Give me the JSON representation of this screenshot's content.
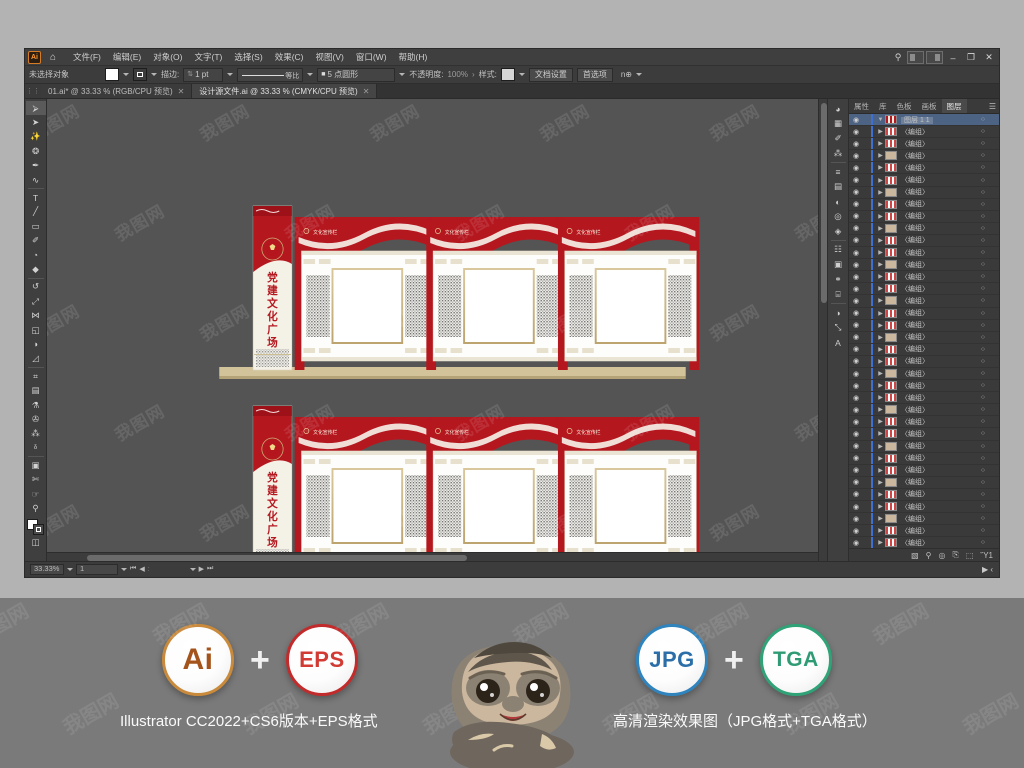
{
  "app": {
    "name": "Adobe Illustrator",
    "logo_text": "Ai",
    "home_icon": "home-icon",
    "search_icon": "search-icon",
    "minimize": "–",
    "restore": "❐",
    "close": "✕"
  },
  "menu": {
    "items": [
      {
        "label": "文件(F)"
      },
      {
        "label": "编辑(E)"
      },
      {
        "label": "对象(O)"
      },
      {
        "label": "文字(T)"
      },
      {
        "label": "选择(S)"
      },
      {
        "label": "效果(C)"
      },
      {
        "label": "视图(V)"
      },
      {
        "label": "窗口(W)"
      },
      {
        "label": "帮助(H)"
      }
    ]
  },
  "control_bar": {
    "selection_status": "未选择对象",
    "stroke_label": "描边:",
    "stroke_weight": "1 pt",
    "stroke_profile": "等比",
    "brush_definition": "5 点圆形",
    "opacity_label": "不透明度:",
    "opacity_value": "100%",
    "style_label": "样式:",
    "document_setup": "文档设置",
    "preferences": "首选项",
    "align_label": "n⊕"
  },
  "tabs": [
    {
      "label": "01.ai* @ 33.33 % (RGB/CPU 预览)",
      "active": false,
      "close": "✕"
    },
    {
      "label": "设计源文件.ai @ 33.33 % (CMYK/CPU 预览)",
      "active": true,
      "close": "✕"
    }
  ],
  "toolbar": {
    "tools": [
      {
        "name": "selection-tool",
        "glyph": "⮚",
        "selected": true
      },
      {
        "name": "direct-selection-tool",
        "glyph": "➤"
      },
      {
        "name": "magic-wand-tool",
        "glyph": "✨"
      },
      {
        "name": "lasso-tool",
        "glyph": "❂"
      },
      {
        "name": "pen-tool",
        "glyph": "✒"
      },
      {
        "name": "curvature-tool",
        "glyph": "∿"
      },
      {
        "name": "type-tool",
        "glyph": "T"
      },
      {
        "name": "line-segment-tool",
        "glyph": "╱"
      },
      {
        "name": "rectangle-tool",
        "glyph": "▭"
      },
      {
        "name": "paintbrush-tool",
        "glyph": "✐"
      },
      {
        "name": "shaper-tool",
        "glyph": "◔"
      },
      {
        "name": "eraser-tool",
        "glyph": "◆"
      },
      {
        "name": "rotate-tool",
        "glyph": "↺"
      },
      {
        "name": "scale-tool",
        "glyph": "⤢"
      },
      {
        "name": "width-tool",
        "glyph": "⋈"
      },
      {
        "name": "free-transform-tool",
        "glyph": "◱"
      },
      {
        "name": "shape-builder-tool",
        "glyph": "◑"
      },
      {
        "name": "perspective-grid-tool",
        "glyph": "◿"
      },
      {
        "name": "mesh-tool",
        "glyph": "⌗"
      },
      {
        "name": "gradient-tool",
        "glyph": "▤"
      },
      {
        "name": "eyedropper-tool",
        "glyph": "⚗"
      },
      {
        "name": "blend-tool",
        "glyph": "✇"
      },
      {
        "name": "symbol-sprayer-tool",
        "glyph": "⁂"
      },
      {
        "name": "column-graph-tool",
        "glyph": "ᵟ"
      },
      {
        "name": "artboard-tool",
        "glyph": "▣"
      },
      {
        "name": "slice-tool",
        "glyph": "✄"
      },
      {
        "name": "hand-tool",
        "glyph": "☞"
      },
      {
        "name": "zoom-tool",
        "glyph": "⚲"
      }
    ]
  },
  "right_panel": {
    "tabs": [
      {
        "label": "属性",
        "active": false
      },
      {
        "label": "库",
        "active": false
      },
      {
        "label": "色板",
        "active": false
      },
      {
        "label": "画板",
        "active": false
      },
      {
        "label": "图层",
        "active": true
      }
    ],
    "panel_menu_icon": "hamburger-icon",
    "icon_rail": [
      {
        "name": "color-icon",
        "glyph": "◕"
      },
      {
        "name": "swatches-icon",
        "glyph": "▦"
      },
      {
        "name": "brushes-icon",
        "glyph": "✐"
      },
      {
        "name": "symbols-icon",
        "glyph": "⁂"
      },
      {
        "name": "stroke-icon",
        "glyph": "≡"
      },
      {
        "name": "gradient-icon",
        "glyph": "▤"
      },
      {
        "name": "transparency-icon",
        "glyph": "◐"
      },
      {
        "name": "appearance-icon",
        "glyph": "◎"
      },
      {
        "name": "graphic-styles-icon",
        "glyph": "◈"
      },
      {
        "name": "layers-icon",
        "glyph": "☷"
      },
      {
        "name": "artboards-icon",
        "glyph": "▣"
      },
      {
        "name": "links-icon",
        "glyph": "⚭"
      },
      {
        "name": "align-icon",
        "glyph": "⌸"
      },
      {
        "name": "pathfinder-icon",
        "glyph": "◑"
      },
      {
        "name": "transform-icon",
        "glyph": "⤡"
      },
      {
        "name": "character-icon",
        "glyph": "A"
      }
    ],
    "layers": {
      "root_name": "图层 1",
      "root_index": "1",
      "child_name": "〈编组〉",
      "child_count": 35,
      "footer_icons": [
        {
          "name": "clipping-mask-icon",
          "glyph": "▧"
        },
        {
          "name": "make-subset-icon",
          "glyph": "⚲"
        },
        {
          "name": "locate-object-icon",
          "glyph": "◎"
        },
        {
          "name": "new-sublayer-icon",
          "glyph": "⎘"
        },
        {
          "name": "new-layer-icon",
          "glyph": "⬚"
        },
        {
          "name": "delete-layer-icon",
          "glyph": "Ὕ1"
        }
      ]
    }
  },
  "status_bar": {
    "zoom": "33.33%",
    "artboard_number": "1",
    "nav_first": "⏮",
    "nav_prev": "◀",
    "nav_next": "▶",
    "nav_last": "⏭",
    "tool_label": ""
  },
  "artwork": {
    "title": "党建文化广场",
    "column_text": "党建文化广场",
    "column_sub": "不忘初心 牢记使命",
    "board_header": "文化宣传栏",
    "emblem": "party-emblem",
    "colors": {
      "red": "#b5171f",
      "deep_red": "#9e1119",
      "cream": "#f3efe3",
      "base_tan": "#c9b48b",
      "board_white": "#fdfdfb",
      "frame_gold": "#c6aa72"
    },
    "boards": [
      {
        "header": "文化宣传栏"
      },
      {
        "header": "文化宣传栏"
      },
      {
        "header": "文化宣传栏"
      }
    ],
    "watermark": "我图网"
  },
  "banner": {
    "left": {
      "badges": [
        {
          "label": "Ai",
          "kind": "badge-ai",
          "name": "ai-format-badge"
        },
        {
          "label": "+",
          "kind": "plus",
          "name": "plus-separator"
        },
        {
          "label": "EPS",
          "kind": "badge-eps",
          "name": "eps-format-badge"
        }
      ],
      "caption": "Illustrator CC2022+CS6版本+EPS格式"
    },
    "right": {
      "badges": [
        {
          "label": "JPG",
          "kind": "badge-jpg",
          "name": "jpg-format-badge"
        },
        {
          "label": "+",
          "kind": "plus",
          "name": "plus-separator"
        },
        {
          "label": "TGA",
          "kind": "badge-tga",
          "name": "tga-format-badge"
        }
      ],
      "caption": "高清渲染效果图（JPG格式+TGA格式）"
    },
    "mascot": "sloth-mascot",
    "watermark": "我图网"
  }
}
